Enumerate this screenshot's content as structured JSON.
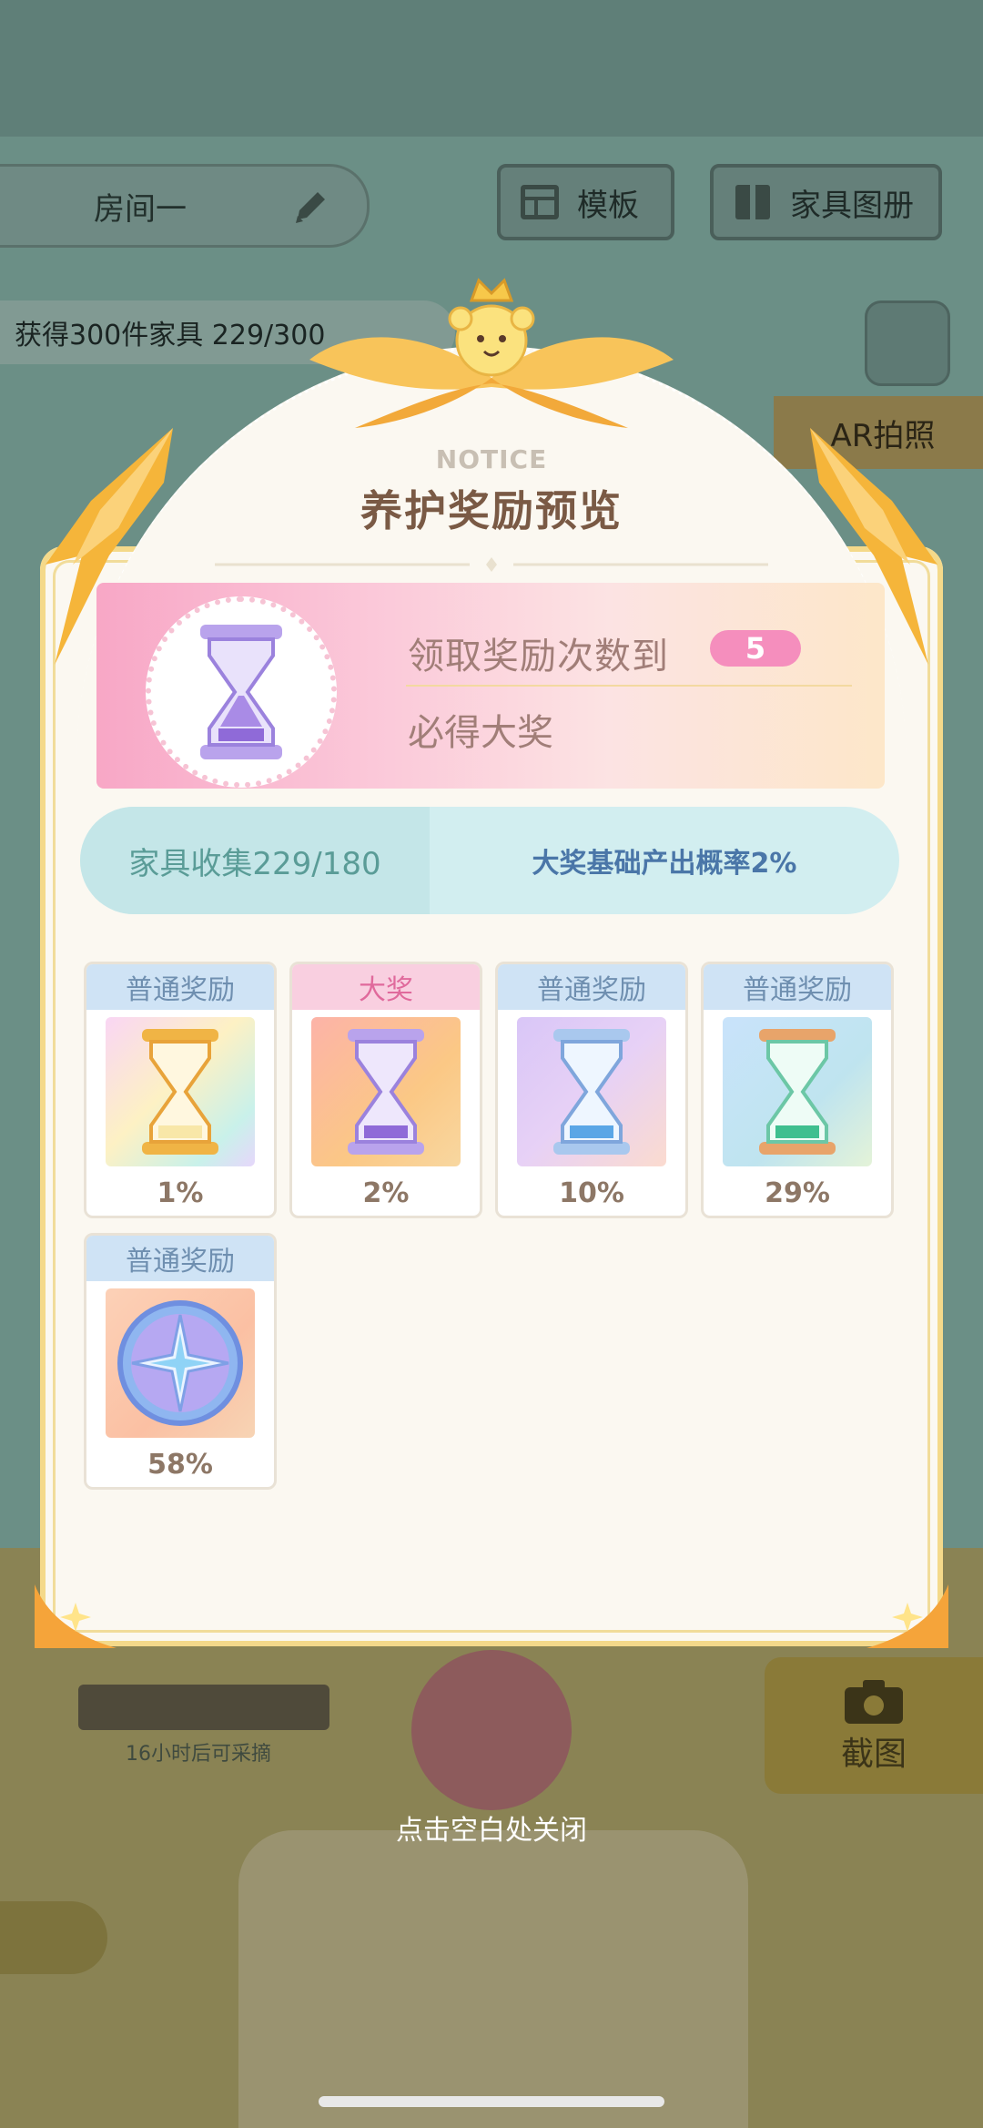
{
  "background": {
    "room_name": "房间一",
    "template_label": "模板",
    "catalog_label": "家具图册",
    "goal_text": "获得300件家具  229/300",
    "ar_label": "AR拍照",
    "screenshot_label": "截图",
    "harvest_text": "16小时后可采摘"
  },
  "dialog": {
    "notice_label": "NOTICE",
    "title": "养护奖励预览",
    "grand_prize": {
      "line1": "领取奖励次数到",
      "count": "5",
      "line2": "必得大奖"
    },
    "stats": {
      "collection": "家具收集229/180",
      "base_rate": "大奖基础产出概率2%"
    },
    "rewards": [
      {
        "label": "普通奖励",
        "percent": "1%",
        "icon": "golden-hourglass-icon",
        "grand": false
      },
      {
        "label": "大奖",
        "percent": "2%",
        "icon": "purple-hourglass-icon",
        "grand": true
      },
      {
        "label": "普通奖励",
        "percent": "10%",
        "icon": "blue-hourglass-icon",
        "grand": false
      },
      {
        "label": "普通奖励",
        "percent": "29%",
        "icon": "green-hourglass-icon",
        "grand": false
      },
      {
        "label": "普通奖励",
        "percent": "58%",
        "icon": "compass-star-coin-icon",
        "grand": false
      }
    ]
  },
  "close_hint": "点击空白处关闭",
  "colors": {
    "accent_pink": "#f58ebd",
    "title_brown": "#7a5a45",
    "teal_text": "#5a9c97",
    "blue_text": "#4a76a8",
    "ribbon_gold": "#f5b53a"
  }
}
